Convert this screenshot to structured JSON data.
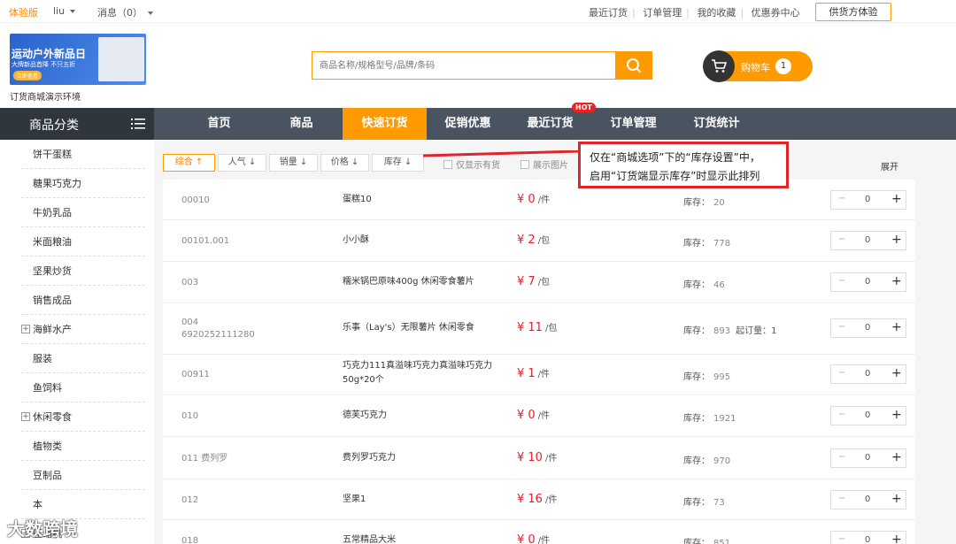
{
  "topbar": {
    "version": "体验版",
    "user": "liu",
    "messages": "消息（0）",
    "links": [
      "最近订货",
      "订单管理",
      "我的收藏",
      "优惠券中心"
    ],
    "supplier_button": "供货方体验"
  },
  "header": {
    "banner_title": "运动户外新品日",
    "banner_sub": "大牌新品首降 不只五折",
    "banner_btn": "立即查看",
    "env_label": "订货商城演示环境",
    "search_placeholder": "商品名称/规格型号/品牌/条码",
    "cart_label": "购物车",
    "cart_count": "1"
  },
  "nav": {
    "category_title": "商品分类",
    "items": [
      "首页",
      "商品",
      "快速订货",
      "促销优惠",
      "最近订货",
      "订单管理",
      "订货统计"
    ],
    "active_index": 2,
    "hot_badge": "HOT"
  },
  "sidebar": {
    "items": [
      {
        "label": "饼干蛋糕",
        "expandable": false
      },
      {
        "label": "糖果巧克力",
        "expandable": false
      },
      {
        "label": "牛奶乳品",
        "expandable": false
      },
      {
        "label": "米面粮油",
        "expandable": false
      },
      {
        "label": "坚果炒货",
        "expandable": false
      },
      {
        "label": "销售成品",
        "expandable": false
      },
      {
        "label": "海鲜水产",
        "expandable": true
      },
      {
        "label": "服装",
        "expandable": false
      },
      {
        "label": "鱼饲料",
        "expandable": false
      },
      {
        "label": "休闲零食",
        "expandable": true
      },
      {
        "label": "植物类",
        "expandable": false
      },
      {
        "label": "豆制品",
        "expandable": false
      },
      {
        "label": "本",
        "expandable": false
      },
      {
        "label": "压缩机",
        "expandable": true
      }
    ]
  },
  "sort": {
    "options": [
      "综合 ↑",
      "人气 ↓",
      "销量 ↓",
      "价格 ↓",
      "库存 ↓"
    ],
    "active_index": 0,
    "only_in_stock": "仅显示有货",
    "show_images": "展示图片",
    "expand": "展开"
  },
  "annotation": {
    "line1": "仅在“商城选项”下的“库存设置”中，",
    "line2": "启用“订货端显示库存”时显示此排列"
  },
  "labels": {
    "stock": "库存：",
    "min_order": "起订量：",
    "minus": "−",
    "plus": "+"
  },
  "products": [
    {
      "code": "00010",
      "code2": "",
      "name": "蛋糕10",
      "price": "¥ 0",
      "unit": "/件",
      "stock": "20",
      "min_order": "",
      "qty": "0"
    },
    {
      "code": "00101.001",
      "code2": "",
      "name": "小小酥",
      "price": "¥ 2",
      "unit": "/包",
      "stock": "778",
      "min_order": "",
      "qty": "0"
    },
    {
      "code": "003",
      "code2": "",
      "name": "糯米锅巴原味400g 休闲零食薯片",
      "price": "¥ 7",
      "unit": "/包",
      "stock": "46",
      "min_order": "",
      "qty": "0"
    },
    {
      "code": "004",
      "code2": "6920252111280",
      "name": "乐事（Lay's）无限薯片 休闲零食",
      "price": "¥ 11",
      "unit": "/包",
      "stock": "893",
      "min_order": "1",
      "qty": "0"
    },
    {
      "code": "00911",
      "code2": "",
      "name": "巧克力111真溢味巧克力真溢味巧克力50g*20个",
      "price": "¥ 1",
      "unit": "/件",
      "stock": "995",
      "min_order": "",
      "qty": "0"
    },
    {
      "code": "010",
      "code2": "",
      "name": "德芙巧克力",
      "price": "¥ 0",
      "unit": "/件",
      "stock": "1921",
      "min_order": "",
      "qty": "0"
    },
    {
      "code": "011  费列罗",
      "code2": "",
      "name": "费列罗巧克力",
      "price": "¥ 10",
      "unit": "/件",
      "stock": "970",
      "min_order": "",
      "qty": "0"
    },
    {
      "code": "012",
      "code2": "",
      "name": "坚果1",
      "price": "¥ 16",
      "unit": "/件",
      "stock": "73",
      "min_order": "",
      "qty": "0"
    },
    {
      "code": "018",
      "code2": "",
      "name": "五常精品大米",
      "price": "¥ 0",
      "unit": "/件",
      "stock": "851",
      "min_order": "",
      "qty": "0"
    }
  ],
  "watermark": "大数跨境"
}
